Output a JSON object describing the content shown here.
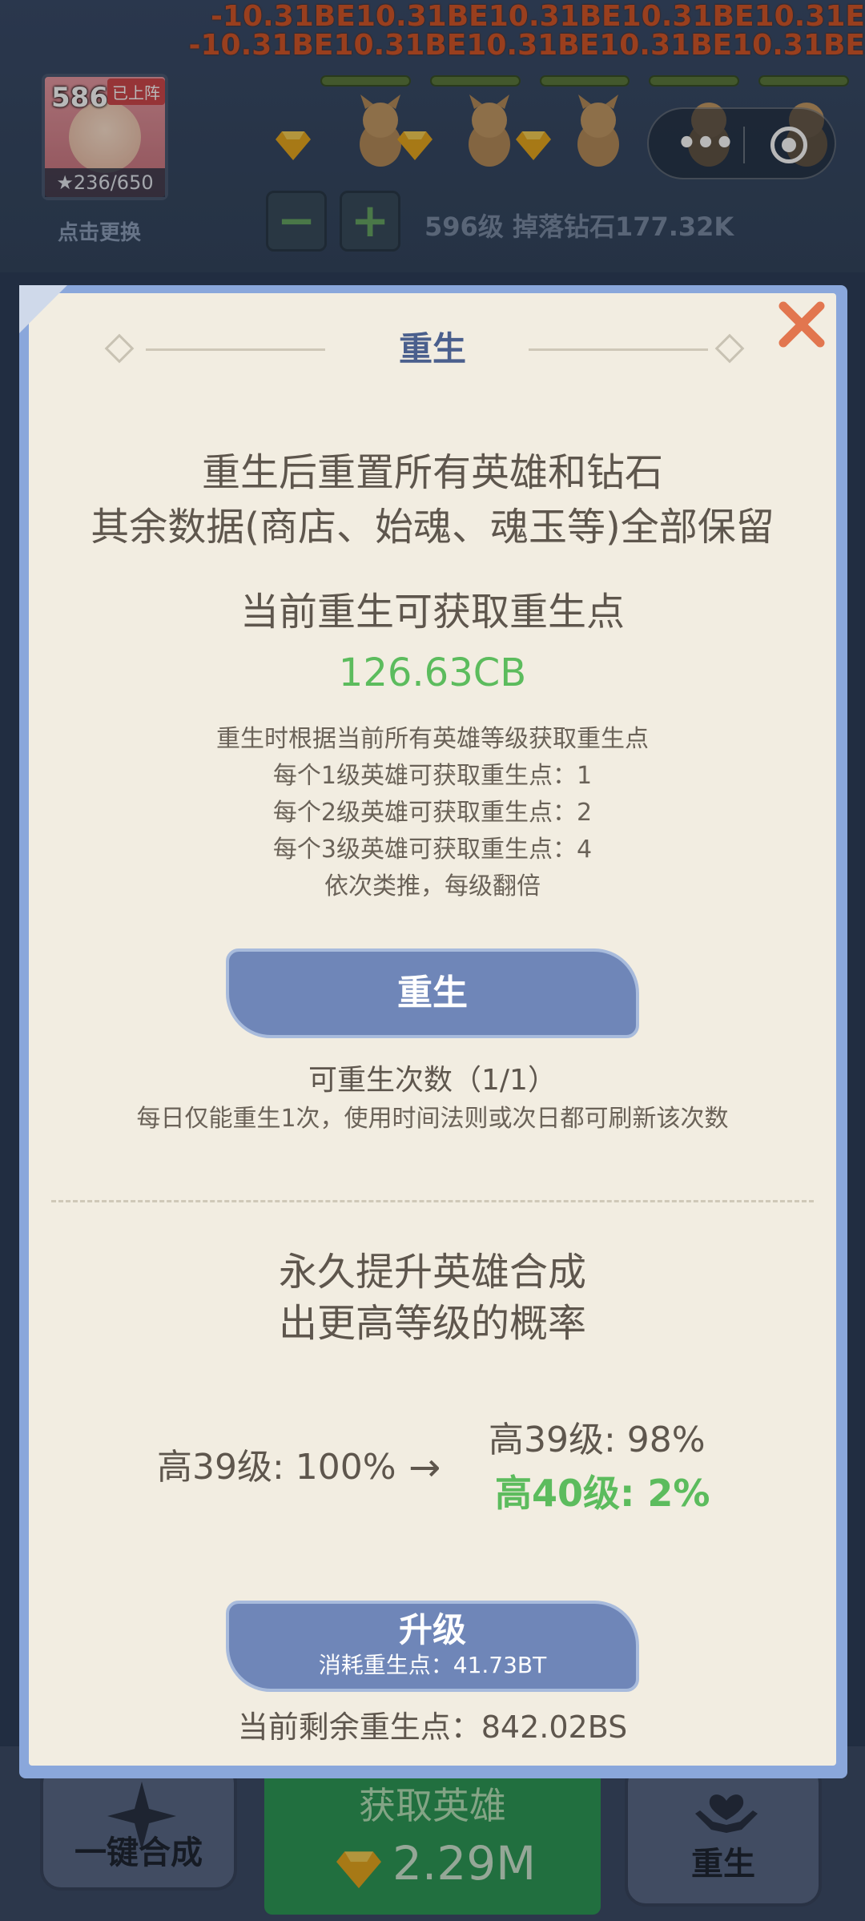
{
  "background": {
    "damage_line_1": "-10.31BE10.31BE10.31BE10.31BE10.31E",
    "damage_line_2": "-10.31BE10.31BE10.31BE10.31BE10.31BE",
    "hero": {
      "level": "586",
      "badge": "已上阵",
      "stars": "★236/650",
      "change_label": "点击更换"
    },
    "controls": {
      "minus": "−",
      "plus": "+",
      "drop_info": "596级 掉落钻石177.32K"
    },
    "capsule": {
      "more": "•••"
    },
    "bottom_nav": {
      "merge_label": "一键合成",
      "get_hero_label": "获取英雄",
      "get_hero_cost": "2.29M",
      "rebirth_label": "重生"
    }
  },
  "modal": {
    "title": "重生",
    "desc_line1": "重生后重置所有英雄和钻石",
    "desc_line2": "其余数据(商店、始魂、魂玉等)全部保留",
    "points_title": "当前重生可获取重生点",
    "points_value": "126.63CB",
    "rules": [
      "重生时根据当前所有英雄等级获取重生点",
      "每个1级英雄可获取重生点：1",
      "每个2级英雄可获取重生点：2",
      "每个3级英雄可获取重生点：4",
      "依次类推，每级翻倍"
    ],
    "rebirth_button": "重生",
    "rebirth_count": "可重生次数（1/1）",
    "daily_note": "每日仅能重生1次，使用时间法则或次日都可刷新该次数",
    "perm_line1": "永久提升英雄合成",
    "perm_line2": "出更高等级的概率",
    "current_rate": "高39级: 100%",
    "arrow": "→",
    "new_rate_1": "高39级: 98%",
    "new_rate_2": "高40级: 2%",
    "upgrade_button": "升级",
    "upgrade_cost": "消耗重生点：41.73BT",
    "remaining": "当前剩余重生点：842.02BS"
  },
  "colors": {
    "accent_green": "#5cbc5d",
    "button_blue": "#6f86b8",
    "modal_frame": "#8aa7db",
    "close_orange": "#e2764f",
    "title_blue": "#4a5f8d"
  }
}
